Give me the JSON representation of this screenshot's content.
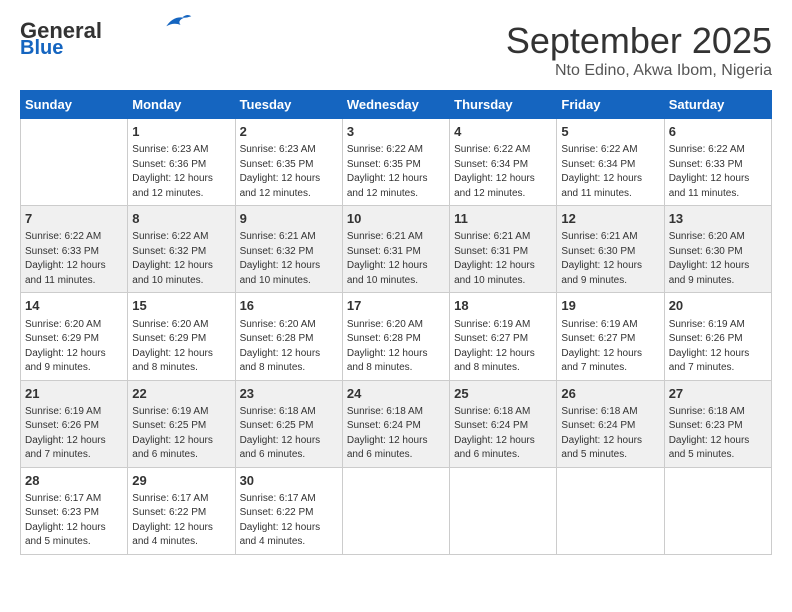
{
  "header": {
    "logo_line1": "General",
    "logo_line2": "Blue",
    "month": "September 2025",
    "location": "Nto Edino, Akwa Ibom, Nigeria"
  },
  "weekdays": [
    "Sunday",
    "Monday",
    "Tuesday",
    "Wednesday",
    "Thursday",
    "Friday",
    "Saturday"
  ],
  "weeks": [
    [
      {
        "day": "",
        "info": ""
      },
      {
        "day": "1",
        "info": "Sunrise: 6:23 AM\nSunset: 6:36 PM\nDaylight: 12 hours\nand 12 minutes."
      },
      {
        "day": "2",
        "info": "Sunrise: 6:23 AM\nSunset: 6:35 PM\nDaylight: 12 hours\nand 12 minutes."
      },
      {
        "day": "3",
        "info": "Sunrise: 6:22 AM\nSunset: 6:35 PM\nDaylight: 12 hours\nand 12 minutes."
      },
      {
        "day": "4",
        "info": "Sunrise: 6:22 AM\nSunset: 6:34 PM\nDaylight: 12 hours\nand 12 minutes."
      },
      {
        "day": "5",
        "info": "Sunrise: 6:22 AM\nSunset: 6:34 PM\nDaylight: 12 hours\nand 11 minutes."
      },
      {
        "day": "6",
        "info": "Sunrise: 6:22 AM\nSunset: 6:33 PM\nDaylight: 12 hours\nand 11 minutes."
      }
    ],
    [
      {
        "day": "7",
        "info": "Sunrise: 6:22 AM\nSunset: 6:33 PM\nDaylight: 12 hours\nand 11 minutes."
      },
      {
        "day": "8",
        "info": "Sunrise: 6:22 AM\nSunset: 6:32 PM\nDaylight: 12 hours\nand 10 minutes."
      },
      {
        "day": "9",
        "info": "Sunrise: 6:21 AM\nSunset: 6:32 PM\nDaylight: 12 hours\nand 10 minutes."
      },
      {
        "day": "10",
        "info": "Sunrise: 6:21 AM\nSunset: 6:31 PM\nDaylight: 12 hours\nand 10 minutes."
      },
      {
        "day": "11",
        "info": "Sunrise: 6:21 AM\nSunset: 6:31 PM\nDaylight: 12 hours\nand 10 minutes."
      },
      {
        "day": "12",
        "info": "Sunrise: 6:21 AM\nSunset: 6:30 PM\nDaylight: 12 hours\nand 9 minutes."
      },
      {
        "day": "13",
        "info": "Sunrise: 6:20 AM\nSunset: 6:30 PM\nDaylight: 12 hours\nand 9 minutes."
      }
    ],
    [
      {
        "day": "14",
        "info": "Sunrise: 6:20 AM\nSunset: 6:29 PM\nDaylight: 12 hours\nand 9 minutes."
      },
      {
        "day": "15",
        "info": "Sunrise: 6:20 AM\nSunset: 6:29 PM\nDaylight: 12 hours\nand 8 minutes."
      },
      {
        "day": "16",
        "info": "Sunrise: 6:20 AM\nSunset: 6:28 PM\nDaylight: 12 hours\nand 8 minutes."
      },
      {
        "day": "17",
        "info": "Sunrise: 6:20 AM\nSunset: 6:28 PM\nDaylight: 12 hours\nand 8 minutes."
      },
      {
        "day": "18",
        "info": "Sunrise: 6:19 AM\nSunset: 6:27 PM\nDaylight: 12 hours\nand 8 minutes."
      },
      {
        "day": "19",
        "info": "Sunrise: 6:19 AM\nSunset: 6:27 PM\nDaylight: 12 hours\nand 7 minutes."
      },
      {
        "day": "20",
        "info": "Sunrise: 6:19 AM\nSunset: 6:26 PM\nDaylight: 12 hours\nand 7 minutes."
      }
    ],
    [
      {
        "day": "21",
        "info": "Sunrise: 6:19 AM\nSunset: 6:26 PM\nDaylight: 12 hours\nand 7 minutes."
      },
      {
        "day": "22",
        "info": "Sunrise: 6:19 AM\nSunset: 6:25 PM\nDaylight: 12 hours\nand 6 minutes."
      },
      {
        "day": "23",
        "info": "Sunrise: 6:18 AM\nSunset: 6:25 PM\nDaylight: 12 hours\nand 6 minutes."
      },
      {
        "day": "24",
        "info": "Sunrise: 6:18 AM\nSunset: 6:24 PM\nDaylight: 12 hours\nand 6 minutes."
      },
      {
        "day": "25",
        "info": "Sunrise: 6:18 AM\nSunset: 6:24 PM\nDaylight: 12 hours\nand 6 minutes."
      },
      {
        "day": "26",
        "info": "Sunrise: 6:18 AM\nSunset: 6:24 PM\nDaylight: 12 hours\nand 5 minutes."
      },
      {
        "day": "27",
        "info": "Sunrise: 6:18 AM\nSunset: 6:23 PM\nDaylight: 12 hours\nand 5 minutes."
      }
    ],
    [
      {
        "day": "28",
        "info": "Sunrise: 6:17 AM\nSunset: 6:23 PM\nDaylight: 12 hours\nand 5 minutes."
      },
      {
        "day": "29",
        "info": "Sunrise: 6:17 AM\nSunset: 6:22 PM\nDaylight: 12 hours\nand 4 minutes."
      },
      {
        "day": "30",
        "info": "Sunrise: 6:17 AM\nSunset: 6:22 PM\nDaylight: 12 hours\nand 4 minutes."
      },
      {
        "day": "",
        "info": ""
      },
      {
        "day": "",
        "info": ""
      },
      {
        "day": "",
        "info": ""
      },
      {
        "day": "",
        "info": ""
      }
    ]
  ]
}
